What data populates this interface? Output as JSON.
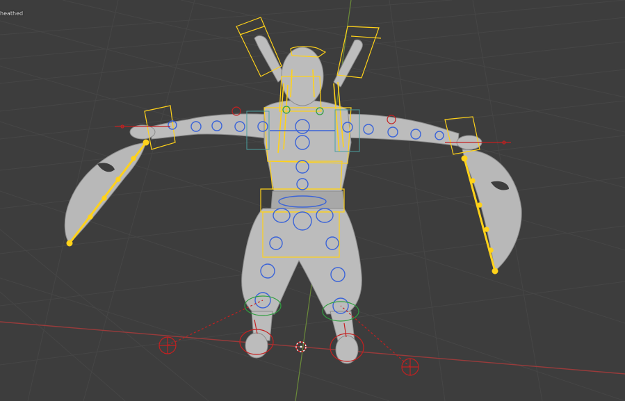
{
  "viewport": {
    "object_label": "heathed",
    "background_color": "#3d3d3d",
    "grid_color": "#464646",
    "x_axis_color": "#9a3b3b",
    "y_axis_color": "#6a8a3a",
    "mesh_color": "#c8c8c8",
    "bone_color": "#ffd21a",
    "ik_control_color": "#c42020",
    "fk_control_color": "#3a63d8",
    "spine_control_color": "#30a040",
    "panel_color": "#4a9fa0"
  },
  "icons": {
    "cursor": "3d-cursor-icon"
  }
}
